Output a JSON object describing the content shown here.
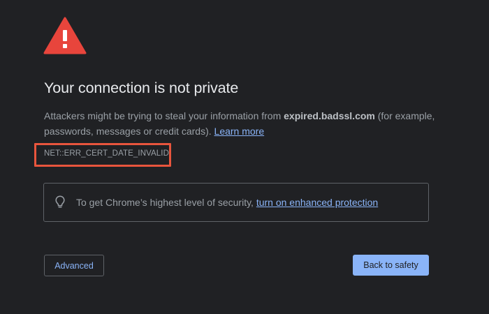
{
  "icons": {
    "warning": "warning-triangle-icon",
    "hint": "lightbulb-icon"
  },
  "colors": {
    "background": "#202124",
    "warning_red": "#e8453c",
    "link_blue": "#8ab4f8",
    "highlight_border": "#e8553d"
  },
  "title": "Your connection is not private",
  "body": {
    "text_before": "Attackers might be trying to steal your information from ",
    "domain": "expired.badssl.com",
    "text_after": " (for example, passwords, messages or credit cards). ",
    "learn_more": "Learn more"
  },
  "error_code": "NET::ERR_CERT_DATE_INVALID",
  "enhanced_protection": {
    "text": "To get Chrome’s highest level of security, ",
    "link": "turn on enhanced protection"
  },
  "buttons": {
    "advanced": "Advanced",
    "back_to_safety": "Back to safety"
  }
}
